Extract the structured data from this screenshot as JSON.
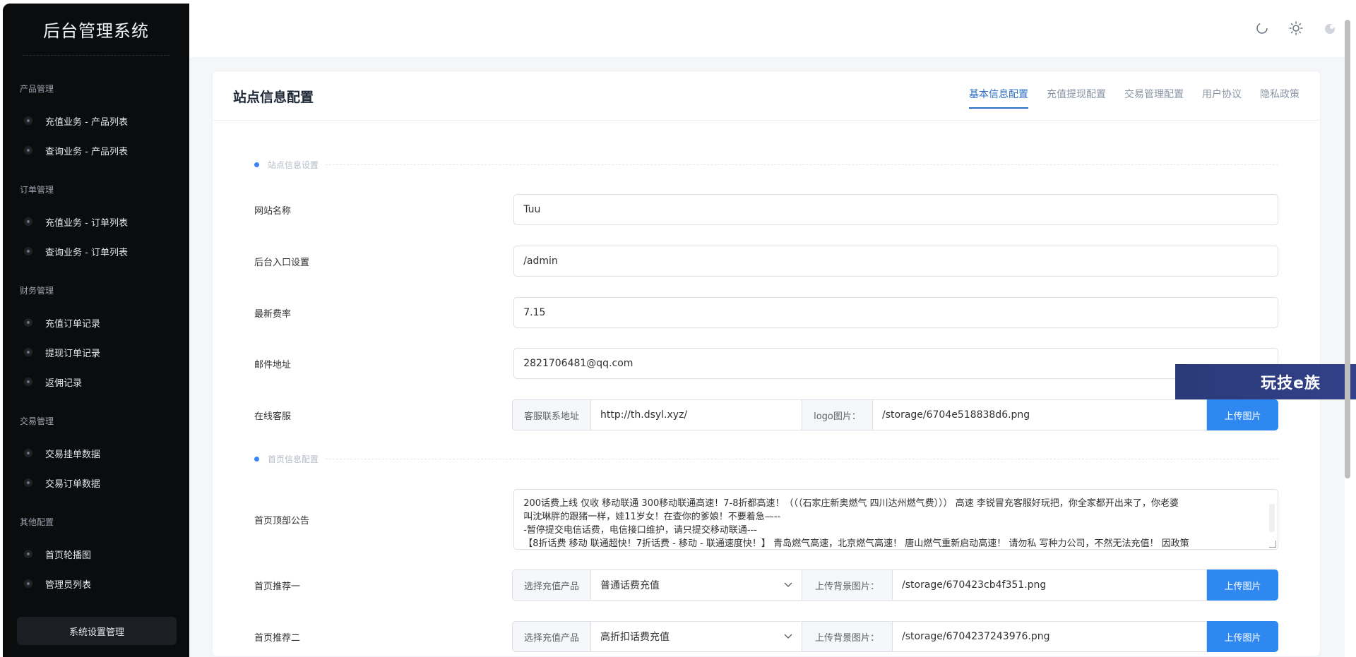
{
  "app": {
    "title": "后台管理系统",
    "system_button": "系统设置管理"
  },
  "sidebar": {
    "groups": [
      {
        "title": "产品管理",
        "items": [
          "充值业务 - 产品列表",
          "查询业务 - 产品列表"
        ]
      },
      {
        "title": "订单管理",
        "items": [
          "充值业务 - 订单列表",
          "查询业务 - 订单列表"
        ]
      },
      {
        "title": "财务管理",
        "items": [
          "充值订单记录",
          "提现订单记录",
          "返佣记录"
        ]
      },
      {
        "title": "交易管理",
        "items": [
          "交易挂单数据",
          "交易订单数据"
        ]
      },
      {
        "title": "其他配置",
        "items": [
          "首页轮播图",
          "管理员列表"
        ]
      }
    ]
  },
  "topbar": {
    "icons": [
      "refresh-icon",
      "sun-icon",
      "theme-toggle-icon"
    ]
  },
  "page": {
    "title": "站点信息配置",
    "tabs": [
      "基本信息配置",
      "充值提现配置",
      "交易管理配置",
      "用户协议",
      "隐私政策"
    ],
    "active_tab": "基本信息配置"
  },
  "sections": {
    "site": "站点信息设置",
    "home": "首页信息配置"
  },
  "form": {
    "site_name": {
      "label": "网站名称",
      "value": "Tuu"
    },
    "admin_entry": {
      "label": "后台入口设置",
      "value": "/admin"
    },
    "rate": {
      "label": "最新费率",
      "value": "7.15"
    },
    "email": {
      "label": "邮件地址",
      "value": "2821706481@qq.com"
    },
    "service": {
      "label": "在线客服",
      "contact_prefix": "客服联系地址",
      "contact_value": "http://th.dsyl.xyz/",
      "logo_prefix": "logo图片：",
      "logo_value": "/storage/6704e518838d6.png",
      "upload": "上传图片"
    },
    "notice": {
      "label": "首页顶部公告",
      "lines": [
        "200话费上线 仅收 移动联通 300移动联通高速！7-8折都高速！（（（石家庄新奥燃气 四川达州燃气费））） 高速 李锐冒充客服好玩把，你全家都开出来了，你老婆",
        "叫沈琳胖的跟猪一样，娃11岁女！在查你的爹娘！不要着急—--",
        "-暂停提交电信话费，电信接口维护，请只提交移动联通---",
        "【8折话费 移动 联通超快！7折话费 - 移动 - 联通速度快！】 青岛燃气高速，北京燃气高速！ 唐山燃气重新启动高速！ 请勿私 写种力公司，不然无法充值！ 因政策"
      ]
    },
    "rec1": {
      "label": "首页推荐一",
      "select_prefix": "选择充值产品",
      "select_value": "普通话费充值",
      "bg_prefix": "上传背景图片：",
      "bg_value": "/storage/670423cb4f351.png",
      "upload": "上传图片"
    },
    "rec2": {
      "label": "首页推荐二",
      "select_prefix": "选择充值产品",
      "select_value": "高折扣话费充值",
      "bg_prefix": "上传背景图片：",
      "bg_value": "/storage/6704237243976.png",
      "upload": "上传图片"
    }
  },
  "watermark": "玩技e族"
}
